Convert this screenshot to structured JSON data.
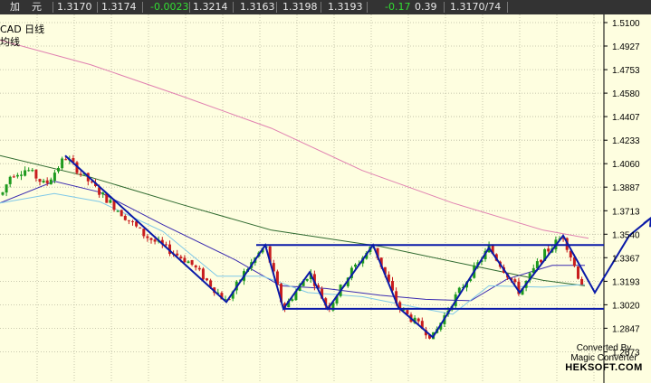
{
  "quote_bar": {
    "label_add": "加",
    "label_unit": "元",
    "fields": [
      "1.3170",
      "1.3174",
      "-0.0023",
      "1.3214",
      "1.3163",
      "1.3198",
      "1.3193",
      "-0.17",
      "0.39",
      "1.3170/74"
    ],
    "field_colors": [
      "#e8e8e8",
      "#e8e8e8",
      "#33dd33",
      "#e8e8e8",
      "#e8e8e8",
      "#e8e8e8",
      "#e8e8e8",
      "#33dd33",
      "#e8e8e8",
      "#e8e8e8"
    ]
  },
  "chart_header": {
    "symbol": "CAD  日线",
    "indicator": "均线"
  },
  "watermark": {
    "line1": "Converted By",
    "line2": "Magic Converter",
    "line3": "HEKSOFT.COM"
  },
  "colors": {
    "background": "#fefee0",
    "bull_candle": "#1e9a1e",
    "bear_candle": "#c81e1e",
    "ma_long": "#e080b0",
    "ma_mid": "#2f6a2f",
    "ma_short": "#3a2ab0",
    "ma_fast": "#7ec8e8",
    "pattern_lines": "#0a1aa8"
  },
  "chart_data": {
    "type": "candlestick",
    "y_ticks": [
      "1.5100",
      "1.4927",
      "1.4753",
      "1.4580",
      "1.4407",
      "1.4233",
      "1.4060",
      "1.3887",
      "1.3713",
      "1.3540",
      "1.3367",
      "1.3193",
      "1.3020",
      "1.2847",
      "1.2673"
    ],
    "ylim": [
      1.2673,
      1.51
    ],
    "grid": true,
    "price_path": [
      [
        0,
        1.38
      ],
      [
        12,
        1.398
      ],
      [
        30,
        1.402
      ],
      [
        50,
        1.39
      ],
      [
        72,
        1.411
      ],
      [
        105,
        1.388
      ],
      [
        160,
        1.353
      ],
      [
        210,
        1.333
      ],
      [
        250,
        1.304
      ],
      [
        270,
        1.326
      ],
      [
        293,
        1.346
      ],
      [
        313,
        1.299
      ],
      [
        342,
        1.326
      ],
      [
        362,
        1.299
      ],
      [
        388,
        1.327
      ],
      [
        412,
        1.346
      ],
      [
        440,
        1.3
      ],
      [
        478,
        1.278
      ],
      [
        500,
        1.305
      ],
      [
        540,
        1.344
      ],
      [
        574,
        1.311
      ],
      [
        600,
        1.339
      ],
      [
        622,
        1.353
      ],
      [
        638,
        1.324
      ],
      [
        646,
        1.314
      ]
    ],
    "ma_long": [
      [
        0,
        1.497
      ],
      [
        100,
        1.479
      ],
      [
        200,
        1.456
      ],
      [
        300,
        1.432
      ],
      [
        400,
        1.401
      ],
      [
        500,
        1.377
      ],
      [
        600,
        1.357
      ],
      [
        650,
        1.351
      ]
    ],
    "ma_mid": [
      [
        0,
        1.412
      ],
      [
        100,
        1.396
      ],
      [
        200,
        1.376
      ],
      [
        300,
        1.357
      ],
      [
        420,
        1.345
      ],
      [
        520,
        1.331
      ],
      [
        600,
        1.32
      ],
      [
        646,
        1.316
      ]
    ],
    "ma_short": [
      [
        0,
        1.377
      ],
      [
        60,
        1.393
      ],
      [
        110,
        1.385
      ],
      [
        180,
        1.361
      ],
      [
        260,
        1.335
      ],
      [
        310,
        1.316
      ],
      [
        360,
        1.314
      ],
      [
        420,
        1.309
      ],
      [
        470,
        1.306
      ],
      [
        520,
        1.305
      ],
      [
        560,
        1.321
      ],
      [
        610,
        1.331
      ],
      [
        646,
        1.331
      ]
    ],
    "ma_fast": [
      [
        0,
        1.377
      ],
      [
        60,
        1.384
      ],
      [
        110,
        1.378
      ],
      [
        180,
        1.356
      ],
      [
        240,
        1.323
      ],
      [
        290,
        1.323
      ],
      [
        340,
        1.311
      ],
      [
        400,
        1.308
      ],
      [
        460,
        1.3
      ],
      [
        500,
        1.295
      ],
      [
        540,
        1.316
      ],
      [
        600,
        1.315
      ],
      [
        646,
        1.317
      ]
    ],
    "pattern_lines": [
      [
        [
          72,
          1.412
        ],
        [
          250,
          1.304
        ],
        [
          293,
          1.346
        ],
        [
          313,
          1.299
        ],
        [
          342,
          1.326
        ],
        [
          362,
          1.299
        ],
        [
          412,
          1.346
        ],
        [
          440,
          1.3
        ],
        [
          478,
          1.278
        ],
        [
          540,
          1.344
        ],
        [
          574,
          1.311
        ],
        [
          622,
          1.353
        ],
        [
          657,
          1.311
        ],
        [
          695,
          1.353
        ],
        [
          719,
          1.366
        ]
      ],
      [
        [
          283,
          1.346
        ],
        [
          667,
          1.346
        ]
      ],
      [
        [
          312,
          1.299
        ],
        [
          667,
          1.299
        ]
      ]
    ]
  }
}
